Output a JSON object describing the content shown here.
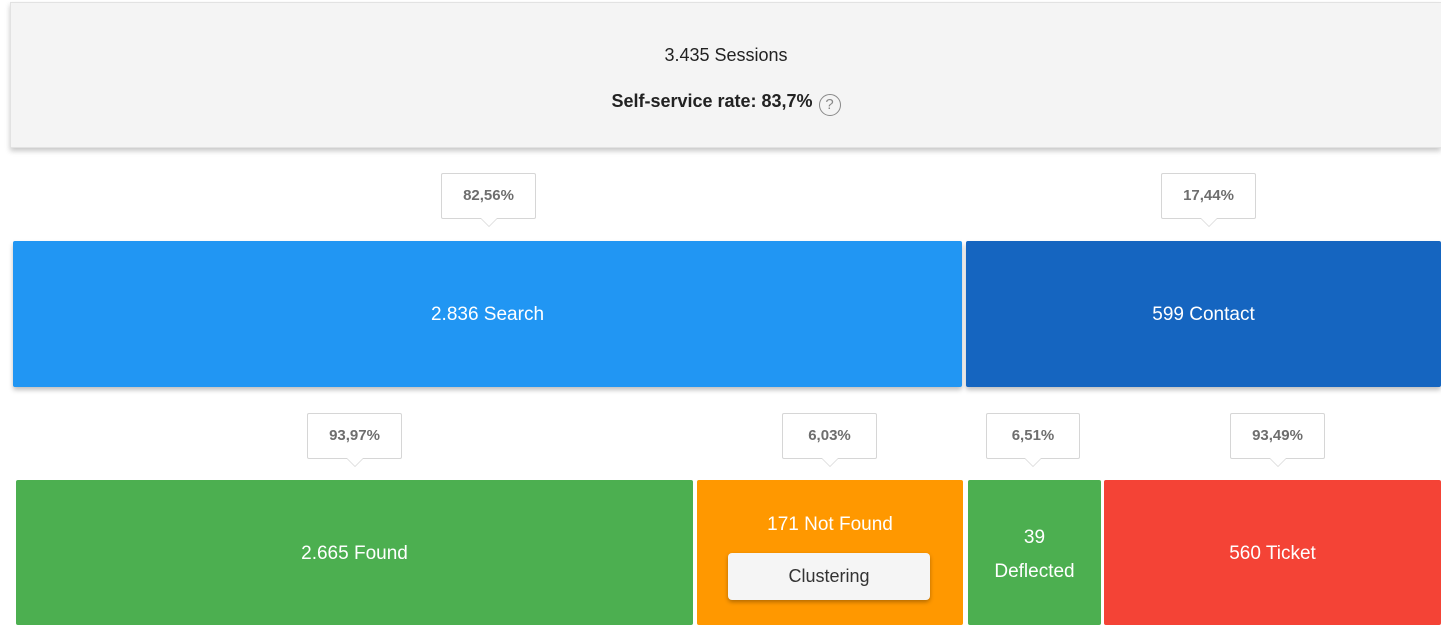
{
  "summary": {
    "sessions": "3.435 Sessions",
    "self_service_rate": "Self-service rate: 83,7%",
    "help_glyph": "?"
  },
  "level1": {
    "search": {
      "pct": "82,56%",
      "label": "2.836 Search",
      "color": "#2196f3"
    },
    "contact": {
      "pct": "17,44%",
      "label": "599 Contact",
      "color": "#1565c0"
    }
  },
  "level2": {
    "found": {
      "pct": "93,97%",
      "label": "2.665 Found",
      "color": "#4caf50"
    },
    "not_found": {
      "pct": "6,03%",
      "label": "171 Not Found",
      "button": "Clustering",
      "color": "#ff9800"
    },
    "deflected": {
      "pct": "6,51%",
      "label_line1": "39",
      "label_line2": "Deflected",
      "color": "#4caf50"
    },
    "ticket": {
      "pct": "93,49%",
      "label": "560 Ticket",
      "color": "#f44336"
    }
  },
  "icons": {
    "help": "help-icon"
  }
}
